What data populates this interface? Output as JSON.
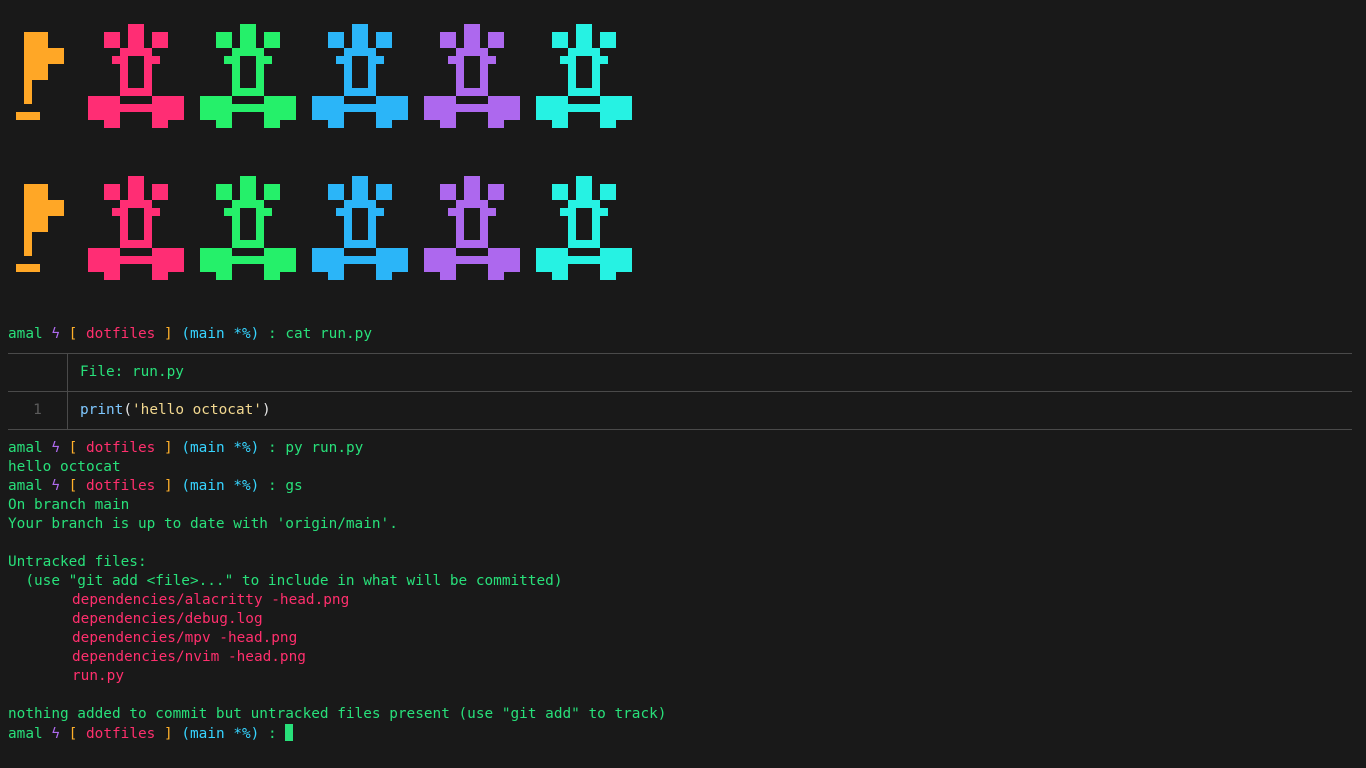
{
  "art": {
    "rows": 2,
    "flag_color": "#ffa726",
    "sprite_colors": [
      "#ff2d74",
      "#25f06a",
      "#2bb5f8",
      "#ad68ee",
      "#26f2e3"
    ]
  },
  "prompt": {
    "user": "amal",
    "symbol": "ϟ",
    "open_bracket": "[",
    "dir": "dotfiles",
    "close_bracket": "]",
    "branch": "(main *%)",
    "sep": ":"
  },
  "commands": {
    "cmd1": "cat run.py",
    "cmd2": "py run.py",
    "cmd3": "gs"
  },
  "bat": {
    "header": "File: run.py",
    "line_number": "1",
    "code_fn": "print",
    "code_open": "(",
    "code_str": "'hello octocat'",
    "code_close": ")"
  },
  "output": {
    "hello": "hello octocat",
    "on_branch": "On branch main",
    "up_to_date": "Your branch is up to date with 'origin/main'.",
    "untracked_header": "Untracked files:",
    "hint": "  (use \"git add <file>...\" to include in what will be committed)",
    "files": [
      "dependencies/alacritty -head.png",
      "dependencies/debug.log",
      "dependencies/mpv -head.png",
      "dependencies/nvim -head.png",
      "run.py"
    ],
    "nothing_added": "nothing added to commit but untracked files present (use \"git add\" to track)"
  }
}
